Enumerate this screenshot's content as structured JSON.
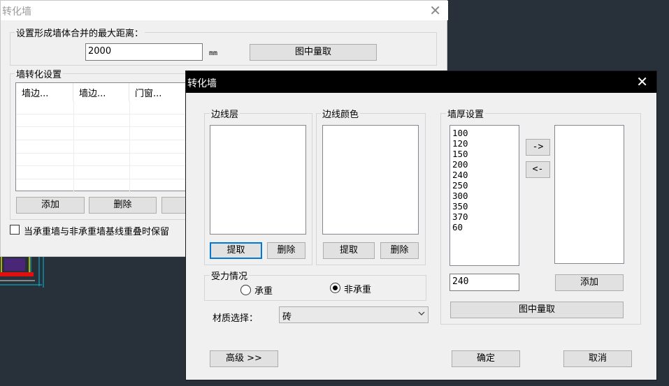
{
  "back_dialog": {
    "title": "转化墙",
    "close_glyph": "✕",
    "merge_group_label": "设置形成墙体合并的最大距离：",
    "distance_value": "2000",
    "unit": "mm",
    "pick_button": "图中量取",
    "convert_group_label": "墙转化设置",
    "columns": [
      "墙边...",
      "墙边...",
      "门窗..."
    ],
    "add_button": "添加",
    "delete_button": "删除",
    "checkbox_label": "当承重墙与非承重墙基线重叠时保留"
  },
  "front_dialog": {
    "title": "转化墙",
    "close_glyph": "✕",
    "edge_layer_label": "边线层",
    "edge_color_label": "边线颜色",
    "extract_button": "提取",
    "delete_button": "删除",
    "wall_thickness_label": "墙厚设置",
    "thickness_list": [
      "100",
      "120",
      "150",
      "200",
      "240",
      "250",
      "300",
      "350",
      "370",
      "60"
    ],
    "move_right_button": "->",
    "move_left_button": "<-",
    "thickness_input": "240",
    "add_button": "添加",
    "pick_button": "图中量取",
    "force_group_label": "受力情况",
    "radio_bearing": "承重",
    "radio_nonbearing": "非承重",
    "selected_radio": "非承重",
    "material_label": "材质选择：",
    "material_value": "砖",
    "advanced_button": "高级 >>",
    "ok_button": "确定",
    "cancel_button": "取消"
  }
}
